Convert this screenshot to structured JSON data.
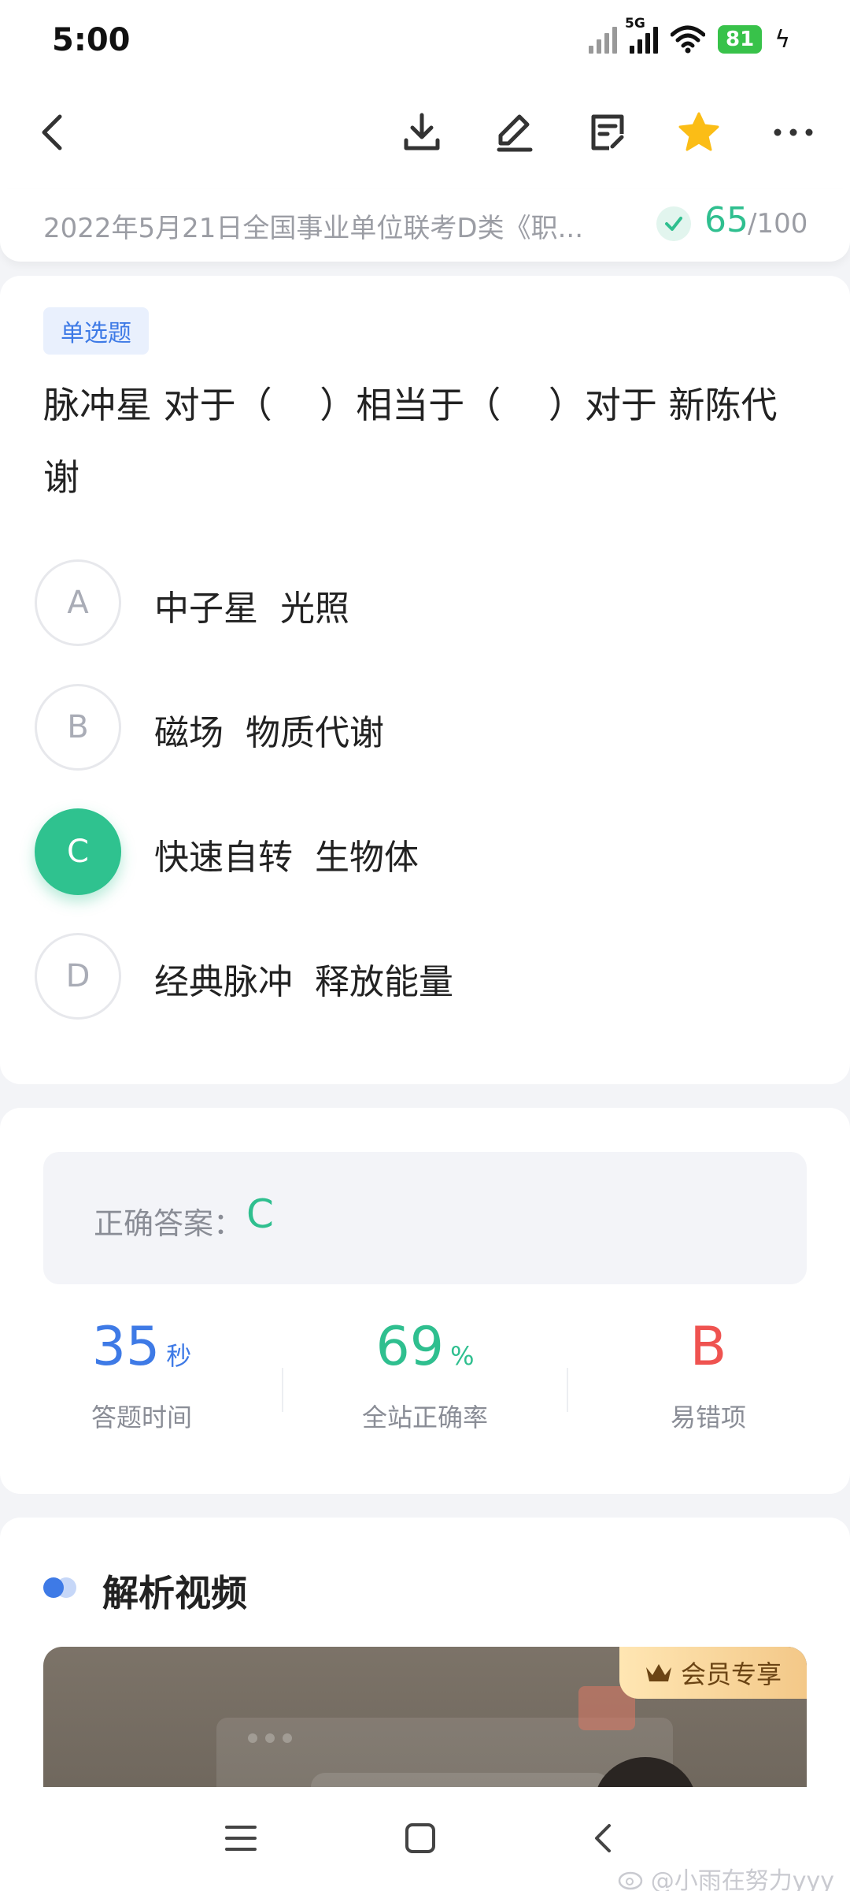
{
  "status_bar": {
    "time": "5:00",
    "network": "5G",
    "battery": "81"
  },
  "toolbar": {
    "icons": [
      "back-icon",
      "download-icon",
      "edit-icon",
      "note-icon",
      "star-icon",
      "more-icon"
    ],
    "star_color": "#fbbd16"
  },
  "source": {
    "text": "2022年5月21日全国事业单位联考D类《职...",
    "score": "65",
    "total": "/100"
  },
  "question": {
    "type": "单选题",
    "stem": "脉冲星 对于（　 ）相当于（　 ）对于 新陈代谢",
    "options": [
      {
        "letter": "A",
        "text": "中子星  光照"
      },
      {
        "letter": "B",
        "text": "磁场  物质代谢"
      },
      {
        "letter": "C",
        "text": "快速自转  生物体",
        "selected": true
      },
      {
        "letter": "D",
        "text": "经典脉冲  释放能量"
      }
    ]
  },
  "answer": {
    "label": "正确答案：",
    "value": "C",
    "stats": [
      {
        "value": "35",
        "unit": "秒",
        "label": "答题时间",
        "color": "#3e7ae6"
      },
      {
        "value": "69",
        "unit": "%",
        "label": "全站正确率",
        "color": "#2fbf8f"
      },
      {
        "value": "B",
        "unit": "",
        "label": "易错项",
        "color": "#ef5350"
      }
    ]
  },
  "video": {
    "title": "解析视频",
    "badge": "会员专享"
  },
  "watermark": "@小雨在努力yyy",
  "colors": {
    "accent_green": "#2fc28f",
    "accent_blue": "#3e7ae6",
    "error_red": "#ef5350"
  }
}
